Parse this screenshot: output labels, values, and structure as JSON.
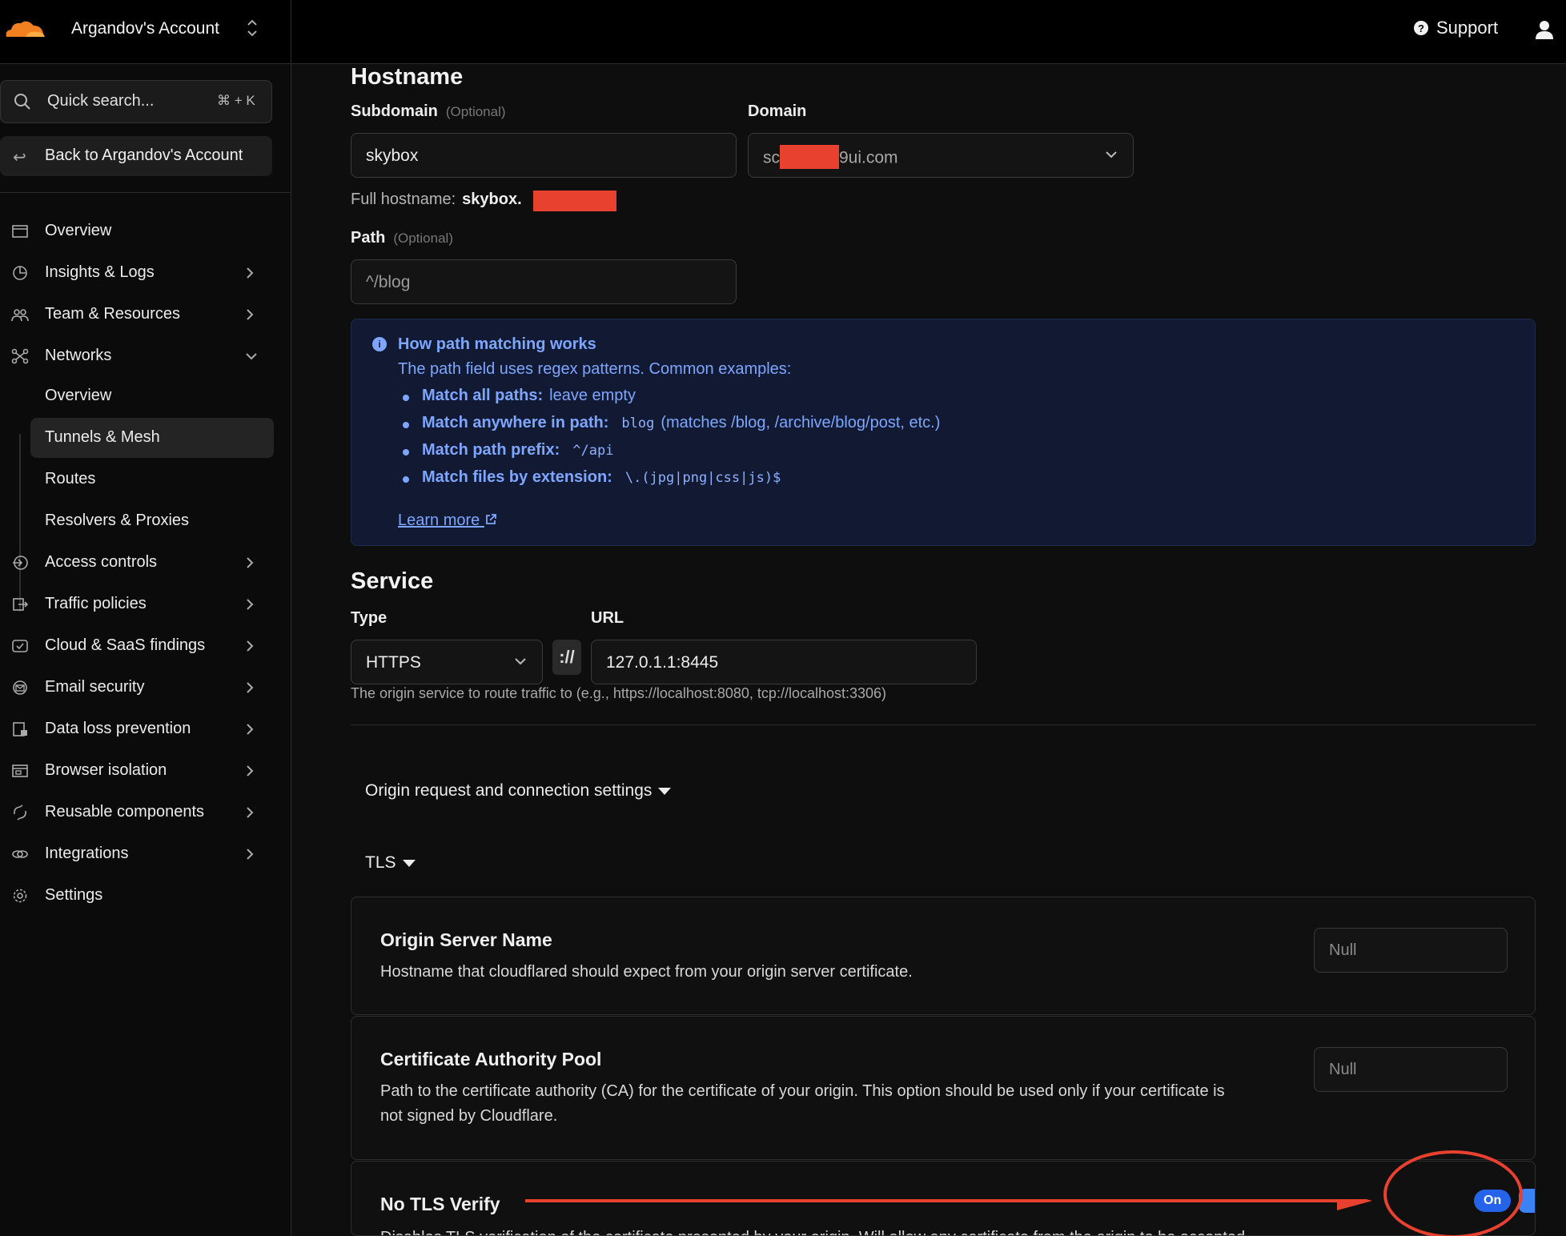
{
  "header": {
    "account_name": "Argandov's Account",
    "support_label": "Support"
  },
  "sidebar": {
    "search_placeholder": "Quick search...",
    "search_shortcut": "⌘ + K",
    "back_label": "Back to Argandov's Account",
    "items": [
      {
        "label": "Overview"
      },
      {
        "label": "Insights & Logs"
      },
      {
        "label": "Team & Resources"
      },
      {
        "label": "Networks"
      },
      {
        "label": "Access controls"
      },
      {
        "label": "Traffic policies"
      },
      {
        "label": "Cloud & SaaS findings"
      },
      {
        "label": "Email security"
      },
      {
        "label": "Data loss prevention"
      },
      {
        "label": "Browser isolation"
      },
      {
        "label": "Reusable components"
      },
      {
        "label": "Integrations"
      },
      {
        "label": "Settings"
      }
    ],
    "networks_sub": [
      {
        "label": "Overview"
      },
      {
        "label": "Tunnels & Mesh",
        "active": true
      },
      {
        "label": "Routes"
      },
      {
        "label": "Resolvers & Proxies"
      }
    ]
  },
  "hostname": {
    "title": "Hostname",
    "subdomain_label": "Subdomain",
    "optional": "(Optional)",
    "subdomain_value": "skybox",
    "domain_label": "Domain",
    "domain_prefix": "sc",
    "domain_suffix": "9ui.com",
    "full_hostname_label": "Full hostname:",
    "full_hostname_value": "skybox.",
    "path_label": "Path",
    "path_placeholder": "^/blog"
  },
  "info": {
    "title": "How path matching works",
    "desc": "The path field uses regex patterns. Common examples:",
    "items": [
      {
        "bold": "Match all paths:",
        "text": "leave empty",
        "code": ""
      },
      {
        "bold": "Match anywhere in path:",
        "code": "blog",
        "text": "(matches /blog, /archive/blog/post, etc.)"
      },
      {
        "bold": "Match path prefix:",
        "code": "^/api",
        "text": ""
      },
      {
        "bold": "Match files by extension:",
        "code": "\\.(jpg|png|css|js)$",
        "text": ""
      }
    ],
    "learn_more": "Learn more"
  },
  "service": {
    "title": "Service",
    "type_label": "Type",
    "type_value": "HTTPS",
    "separator": "://",
    "url_label": "URL",
    "url_value": "127.0.1.1:8445",
    "hint": "The origin service to route traffic to (e.g., https://localhost:8080, tcp://localhost:3306)"
  },
  "origin": {
    "disclosure_label": "Origin request and connection settings",
    "tls_label": "TLS",
    "cards": [
      {
        "title": "Origin Server Name",
        "desc": "Hostname that cloudflared should expect from your origin server certificate.",
        "placeholder": "Null"
      },
      {
        "title": "Certificate Authority Pool",
        "desc": "Path to the certificate authority (CA) for the certificate of your origin. This option should be used only if your certificate is not signed by Cloudflare.",
        "placeholder": "Null"
      },
      {
        "title": "No TLS Verify",
        "desc": "Disables TLS verification of the certificate presented by your origin. Will allow any certificate from the origin to be accepted.",
        "toggle_label": "On",
        "toggle_on": true
      }
    ]
  },
  "colors": {
    "accent": "#3b82f6",
    "info_bg": "#121a33",
    "info_text": "#7ea6ff",
    "annotation": "#e8412f",
    "logo_orange": "#f38020"
  }
}
